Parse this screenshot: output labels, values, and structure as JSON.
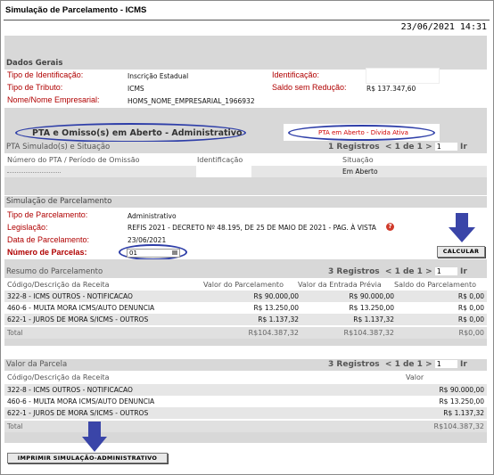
{
  "window": {
    "title": "Simulação de Parcelamento - ICMS",
    "datetime": "23/06/2021 14:31"
  },
  "dados_gerais": {
    "section_title": "Dados Gerais",
    "tipo_identificacao_label": "Tipo de Identificação:",
    "tipo_identificacao_value": "Inscrição Estadual",
    "identificacao_label": "Identificação:",
    "tipo_tributo_label": "Tipo de Tributo:",
    "tipo_tributo_value": "ICMS",
    "saldo_label": "Saldo sem Redução:",
    "saldo_value": "R$ 137.347,60",
    "nome_label": "Nome/Nome Empresarial:",
    "nome_value": "HOMS_NOME_EMPRESARIAL_1966932"
  },
  "tabs": {
    "tab1": "PTA e Omisso(s) em Aberto - Administrativo",
    "tab2": "PTA em Aberto - Dívida Ativa"
  },
  "pta_simulado": {
    "title": "PTA Simulado(s) e Situação",
    "pager": {
      "count": "1",
      "count_label": "Registros",
      "first": "<",
      "page": "1",
      "sep": "de",
      "pages": "1",
      "next": ">",
      "input": "1",
      "go": "Ir"
    },
    "col_numero": "Número do PTA / Período de Omissão",
    "col_identificacao": "Identificação",
    "col_situacao": "Situação",
    "row_situacao": "Em Aberto"
  },
  "simulacao": {
    "title": "Simulação de Parcelamento",
    "tipo_label": "Tipo de Parcelamento:",
    "tipo_value": "Administrativo",
    "legislacao_label": "Legislação:",
    "legislacao_value": "REFIS 2021 - DECRETO Nº 48.195, DE 25 DE MAIO DE 2021 - PAG. À VISTA",
    "help_icon": "?",
    "data_label": "Data de Parcelamento:",
    "data_value": "23/06/2021",
    "parcelas_label": "Número de Parcelas:",
    "parcelas_value": "01",
    "calcular_label": "CALCULAR"
  },
  "resumo": {
    "title": "Resumo do Parcelamento",
    "pager": {
      "count": "3",
      "count_label": "Registros",
      "first": "<",
      "page": "1",
      "sep": "de",
      "pages": "1",
      "next": ">",
      "input": "1",
      "go": "Ir"
    },
    "headers": [
      "Código/Descrição da Receita",
      "Valor do Parcelamento",
      "Valor da Entrada Prévia",
      "Saldo do Parcelamento"
    ],
    "rows": [
      [
        "322-8 - ICMS OUTROS - NOTIFICACAO",
        "R$ 90.000,00",
        "R$ 90.000,00",
        "R$ 0,00"
      ],
      [
        "460-6 - MULTA MORA ICMS/AUTO DENUNCIA",
        "R$ 13.250,00",
        "R$ 13.250,00",
        "R$ 0,00"
      ],
      [
        "622-1 - JUROS DE MORA S/ICMS - OUTROS",
        "R$ 1.137,32",
        "R$ 1.137,32",
        "R$ 0,00"
      ]
    ],
    "total": [
      "Total",
      "R$104.387,32",
      "R$104.387,32",
      "R$0,00"
    ]
  },
  "parcela": {
    "title": "Valor da Parcela",
    "pager": {
      "count": "3",
      "count_label": "Registros",
      "first": "<",
      "page": "1",
      "sep": "de",
      "pages": "1",
      "next": ">",
      "input": "1",
      "go": "Ir"
    },
    "headers": [
      "Código/Descrição da Receita",
      "Valor"
    ],
    "rows": [
      [
        "322-8 - ICMS OUTROS - NOTIFICACAO",
        "R$ 90.000,00"
      ],
      [
        "460-6 - MULTA MORA ICMS/AUTO DENUNCIA",
        "R$ 13.250,00"
      ],
      [
        "622-1 - JUROS DE MORA S/ICMS - OUTROS",
        "R$ 1.137,32"
      ]
    ],
    "total": [
      "Total",
      "R$104.387,32"
    ]
  },
  "imprimir_label": "IMPRIMIR SIMULAÇÃO-ADMINISTRATIVO",
  "colors": {
    "label_red": "#b00000",
    "annotation_blue": "#2e3ea8",
    "band_gray": "#d8d8d8",
    "help_red": "#d03a2a"
  },
  "icons": {
    "arrow": "down-arrow-icon",
    "help": "help-icon",
    "calendar": "calendar-icon"
  }
}
